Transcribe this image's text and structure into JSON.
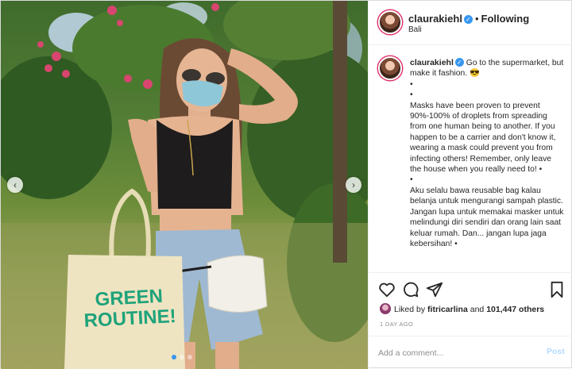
{
  "post": {
    "username": "claurakiehl",
    "separator": "•",
    "follow_status": "Following",
    "location": "Bali",
    "bag_text_line1": "GREEN",
    "bag_text_line2": "ROUTINE!"
  },
  "caption": {
    "username": "claurakiehl",
    "lines": [
      "Go to the supermarket, but make it fashion. 😎",
      "•",
      "•",
      "Masks have been proven to prevent 90%-100% of droplets from spreading from one human being to another. If you happen to be a carrier and don't know it, wearing a mask could prevent you from infecting others! Remember, only leave the house when you really need to! •",
      "•",
      "Aku selalu bawa reusable bag kalau belanja untuk mengurangi sampah plastic. Jangan lupa untuk memakai masker untuk melindungi diri sendiri dan orang lain saat keluar rumah. Dan... jangan lupa jaga kebersihan! •"
    ]
  },
  "likes": {
    "prefix": "Liked by",
    "user": "fitricarlina",
    "conjunction": "and",
    "count_text": "101,447 others"
  },
  "timestamp": "1 DAY AGO",
  "comment": {
    "placeholder": "Add a comment...",
    "post_label": "Post"
  },
  "icons": {
    "like": "heart-icon",
    "comment": "comment-icon",
    "share": "share-icon",
    "save": "bookmark-icon",
    "verified": "verified-badge-icon",
    "prev": "chevron-left-icon",
    "next": "chevron-right-icon"
  },
  "colors": {
    "accent": "#3897f0",
    "post_disabled": "#b3dbff",
    "bag_text": "#1fa37a"
  },
  "carousel": {
    "total": 3,
    "active_index": 0
  }
}
